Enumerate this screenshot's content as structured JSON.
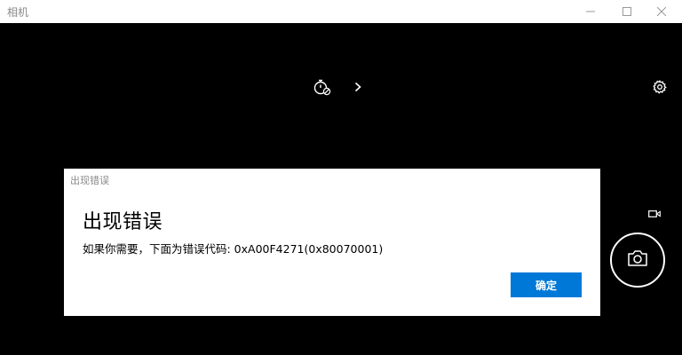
{
  "window": {
    "title": "相机",
    "minimize_icon": "minimize-icon",
    "maximize_icon": "maximize-icon",
    "close_icon": "close-icon"
  },
  "toolbar": {
    "timer_icon": "timer-off-icon",
    "expand_icon": "chevron-right-icon",
    "settings_icon": "gear-icon"
  },
  "right_rail": {
    "video_mode_icon": "video-camera-icon",
    "shutter_icon": "camera-icon"
  },
  "dialog": {
    "caption": "出现错误",
    "heading": "出现错误",
    "message": "如果你需要，下面为错误代码: 0xA00F4271(0x80070001)",
    "ok_label": "确定",
    "ok_color": "#0078d7"
  }
}
